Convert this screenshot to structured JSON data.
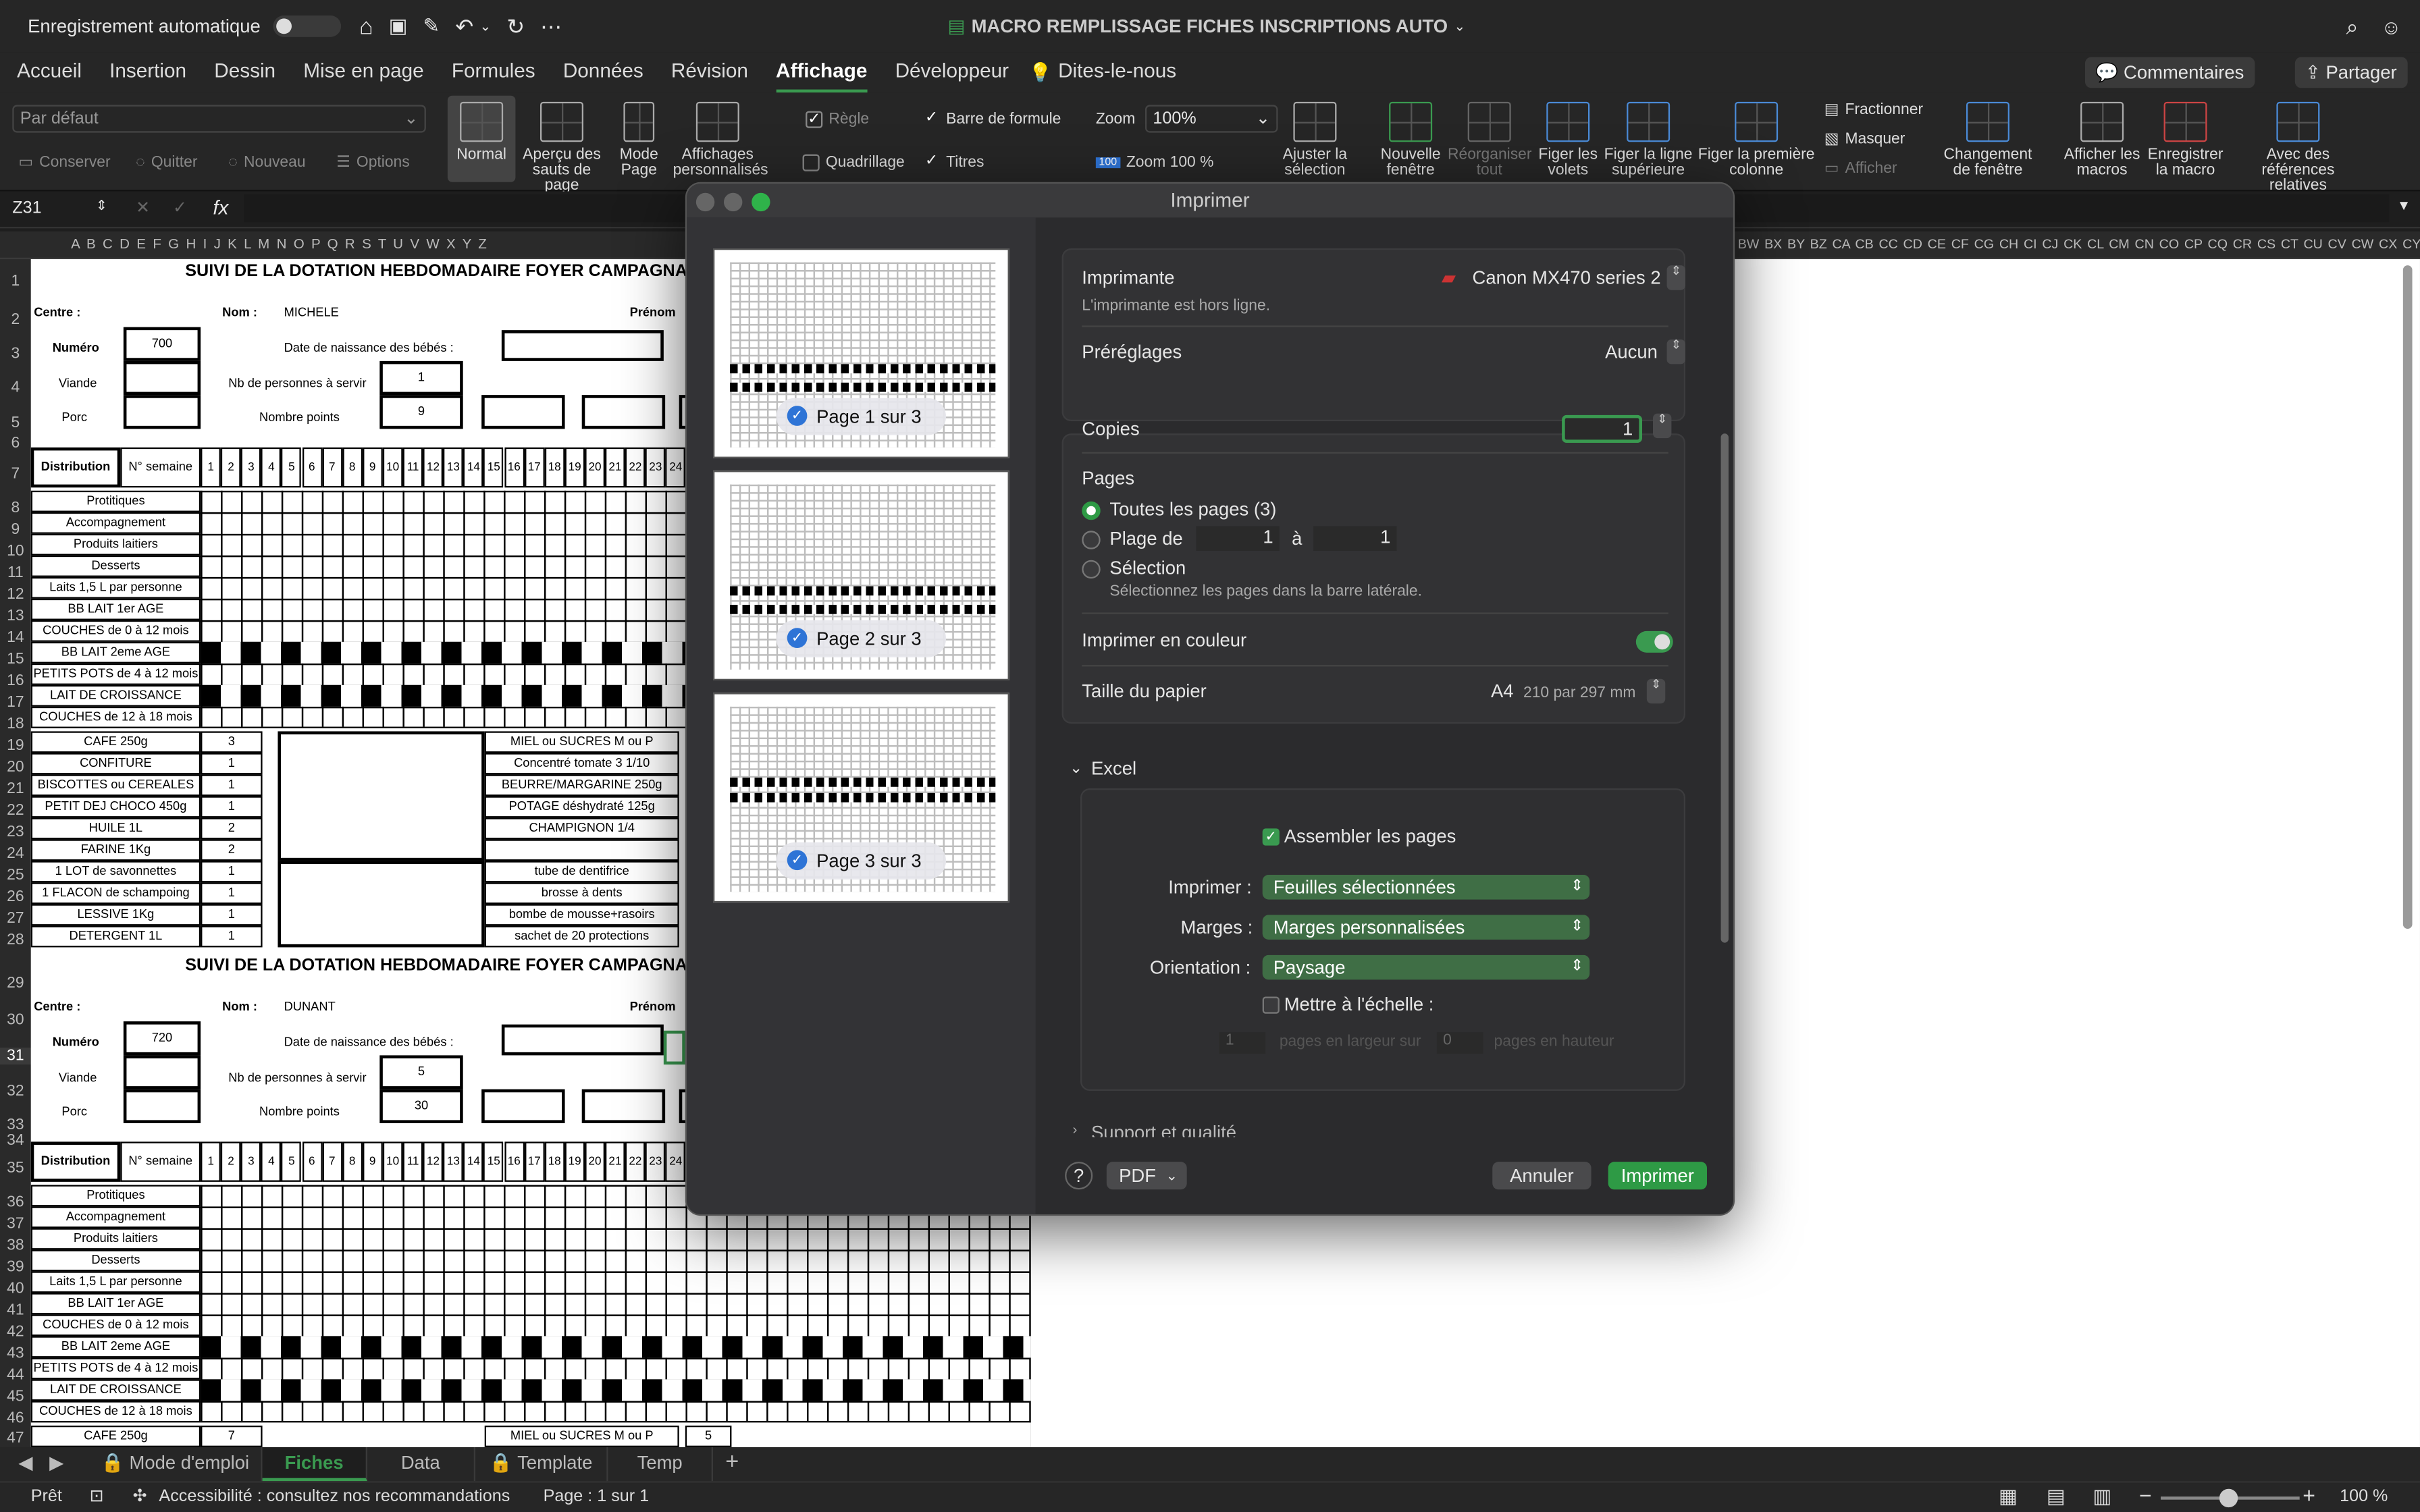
{
  "titlebar": {
    "autosave_label": "Enregistrement automatique",
    "title": "MACRO REMPLISSAGE FICHES INSCRIPTIONS AUTO"
  },
  "menu": {
    "tabs": [
      "Accueil",
      "Insertion",
      "Dessin",
      "Mise en page",
      "Formules",
      "Données",
      "Révision",
      "Affichage",
      "Développeur",
      "Dites-le-nous"
    ],
    "active": "Affichage",
    "comments": "Commentaires",
    "share": "Partager"
  },
  "ribbon": {
    "view_select": "Par défaut",
    "keep": "Conserver",
    "quit": "Quitter",
    "new": "Nouveau",
    "options": "Options",
    "normal": "Normal",
    "page_break": "Aperçu des sauts de page",
    "page_layout": "Mode Page",
    "custom_views": "Affichages personnalisés",
    "ruler": "Règle",
    "formula_bar": "Barre de formule",
    "gridlines": "Quadrillage",
    "headings": "Titres",
    "zoom_label": "Zoom",
    "zoom_value": "100%",
    "zoom100": "Zoom 100 %",
    "fit_selection": "Ajuster la sélection",
    "new_window": "Nouvelle fenêtre",
    "arrange_all": "Réorganiser tout",
    "freeze_panes": "Figer les volets",
    "freeze_top": "Figer la ligne supérieure",
    "freeze_first_col": "Figer la première colonne",
    "split": "Fractionner",
    "hide": "Masquer",
    "unhide": "Afficher",
    "switch_window": "Changement de fenêtre",
    "show_macros": "Afficher les macros",
    "record_macro": "Enregistrer la macro",
    "relative_refs": "Avec des références relatives"
  },
  "formula": {
    "name_box": "Z31",
    "fx": "fx"
  },
  "columns": "A B C D E F G H I J K L M N O P Q R S T U V W X Y Z",
  "columns_right": "BW BX BY BZ CA CB CC CD CE CF CG CH CI CJ CK CL CM CN CO CP CQ CR CS CT CU CV CW CX CY CZ",
  "sheet": {
    "title": "SUIVI DE LA DOTATION HEBDOMADAIRE FOYER CAMPAGNARD",
    "centre_label": "Centre :",
    "nom_label": "Nom :",
    "prenom_label": "Prénom",
    "numero_label": "Numéro",
    "viande_label": "Viande",
    "porc_label": "Porc",
    "dob_label": "Date de naissance des bébés :",
    "nbpers_label": "Nb de personnes à servir",
    "points_label": "Nombre points",
    "distribution": "Distribution",
    "semaine": "N° semaine",
    "weeks": [
      "1",
      "2",
      "3",
      "4",
      "5",
      "6",
      "7",
      "8",
      "9",
      "10",
      "11",
      "12",
      "13",
      "14",
      "15",
      "16",
      "17",
      "18",
      "19",
      "20",
      "21",
      "22",
      "23",
      "24"
    ],
    "block1": {
      "nom": "MICHELE",
      "numero": "700",
      "nbpers": "1",
      "points": "9"
    },
    "block2": {
      "nom": "DUNANT",
      "numero": "720",
      "nbpers": "5",
      "points": "30"
    },
    "products": [
      "Protitiques",
      "Accompagnement",
      "Produits laitiers",
      "Desserts",
      "Laits 1,5 L par personne",
      "BB LAIT 1er AGE",
      "COUCHES de 0 à 12 mois",
      "BB LAIT 2eme AGE",
      "PETITS POTS de 4 à 12 mois",
      "LAIT DE CROISSANCE",
      "COUCHES de 12 à 18 mois"
    ],
    "groceries": [
      [
        "CAFE 250g",
        "3"
      ],
      [
        "CONFITURE",
        "1"
      ],
      [
        "BISCOTTES ou CEREALES",
        "1"
      ],
      [
        "PETIT DEJ CHOCO 450g",
        "1"
      ],
      [
        "HUILE 1L",
        "2"
      ],
      [
        "FARINE 1Kg",
        "2"
      ],
      [
        "1 LOT de savonnettes",
        "1"
      ],
      [
        "1 FLACON de schampoing",
        "1"
      ],
      [
        "LESSIVE 1Kg",
        "1"
      ],
      [
        "DETERGENT 1L",
        "1"
      ]
    ],
    "groceries_right": [
      "MIEL ou SUCRES M ou P",
      "Concentré tomate 3 1/10",
      "BEURRE/MARGARINE 250g",
      "POTAGE déshydraté 125g",
      "CHAMPIGNON 1/4",
      "",
      "tube de dentifrice",
      "brosse à dents",
      "bombe de mousse+rasoirs",
      "sachet de 20 protections"
    ],
    "last_row": {
      "label": "CAFE 250g",
      "qty": "7",
      "right": "MIEL ou SUCRES M ou P",
      "val": "5"
    }
  },
  "dialog": {
    "title": "Imprimer",
    "pages": [
      "Page 1 sur 3",
      "Page 2 sur 3",
      "Page 3 sur 3"
    ],
    "printer_label": "Imprimante",
    "printer_value": "Canon MX470 series 2",
    "printer_status": "L'imprimante est hors ligne.",
    "presets_label": "Préréglages",
    "presets_value": "Aucun",
    "copies_label": "Copies",
    "copies_value": "1",
    "pages_label": "Pages",
    "all_pages": "Toutes les pages (3)",
    "range_label": "Plage de",
    "range_from": "1",
    "range_to_label": "à",
    "range_to": "1",
    "selection_label": "Sélection",
    "selection_hint": "Sélectionnez les pages dans la barre latérale.",
    "color_label": "Imprimer en couleur",
    "paper_label": "Taille du papier",
    "paper_value": "A4",
    "paper_dims": "210 par 297 mm",
    "excel_section": "Excel",
    "collate": "Assembler les pages",
    "print_label": "Imprimer :",
    "print_value": "Feuilles sélectionnées",
    "margins_label": "Marges :",
    "margins_value": "Marges personnalisées",
    "orientation_label": "Orientation :",
    "orientation_value": "Paysage",
    "scale_label": "Mettre à l'échelle :",
    "scale_w": "1",
    "scale_w_label": "pages en largeur sur",
    "scale_h": "0",
    "scale_h_label": "pages en hauteur",
    "support_section": "Support et qualité",
    "help": "?",
    "pdf": "PDF",
    "cancel": "Annuler",
    "print": "Imprimer"
  },
  "sheet_tabs": [
    "Mode d'emploi",
    "Fiches",
    "Data",
    "Template",
    "Temp"
  ],
  "active_sheet": "Fiches",
  "status": {
    "ready": "Prêt",
    "accessibility": "Accessibilité : consultez nos recommandations",
    "page": "Page : 1 sur 1",
    "zoom": "100 %"
  },
  "colors": {
    "accent": "#3a9a50",
    "dialog_bg": "#2b2b2d",
    "print_button": "#2e9a45"
  }
}
